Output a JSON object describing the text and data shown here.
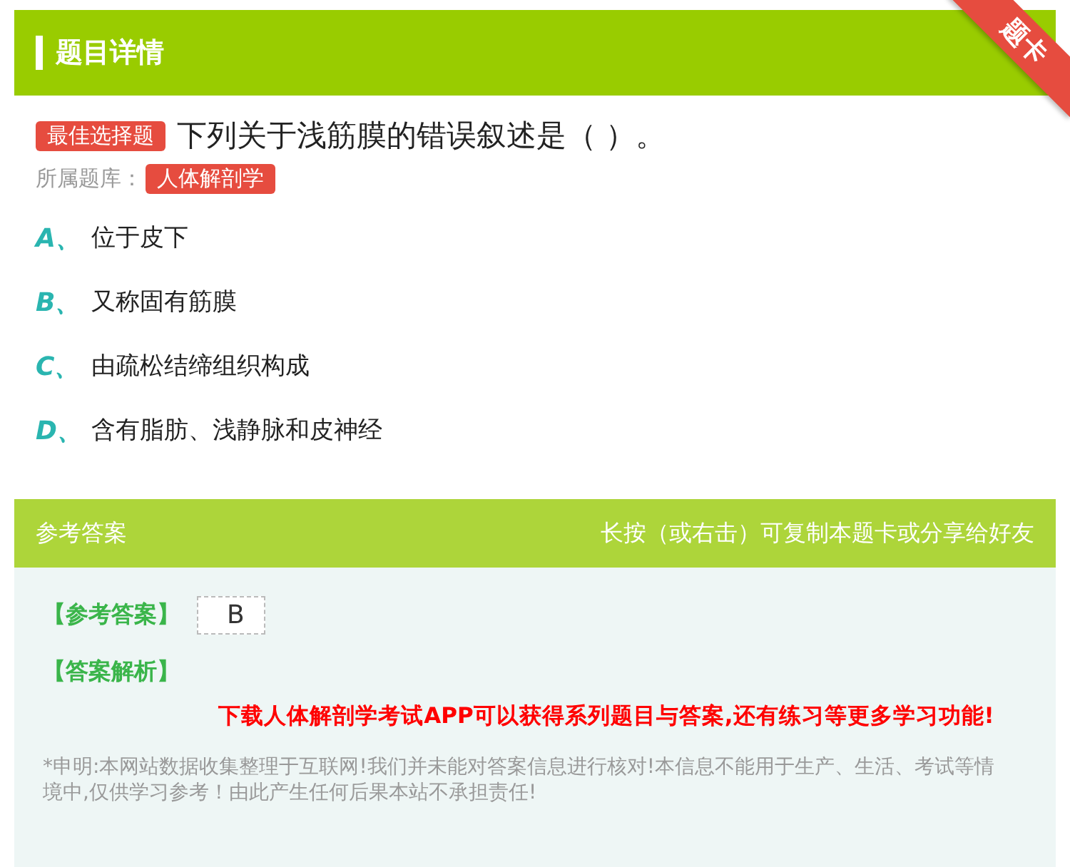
{
  "header": {
    "title": "题目详情",
    "ribbon": "题卡"
  },
  "question": {
    "type_badge": "最佳选择题",
    "text": "下列关于浅筋膜的错误叙述是（ ）。",
    "bank_label": "所属题库：",
    "bank": "人体解剖学"
  },
  "options": [
    {
      "letter": "A、",
      "text": "位于皮下"
    },
    {
      "letter": "B、",
      "text": "又称固有筋膜"
    },
    {
      "letter": "C、",
      "text": "由疏松结缔组织构成"
    },
    {
      "letter": "D、",
      "text": "含有脂肪、浅静脉和皮神经"
    }
  ],
  "answer": {
    "title": "参考答案",
    "hint": "长按（或右击）可复制本题卡或分享给好友",
    "answer_label": "【参考答案】",
    "answer_value": "B",
    "analysis_label": "【答案解析】",
    "promo": "下载人体解剖学考试APP可以获得系列题目与答案,还有练习等更多学习功能!",
    "disclaimer": "*申明:本网站数据收集整理于互联网!我们并未能对答案信息进行核对!本信息不能用于生产、生活、考试等情境中,仅供学习参考！由此产生任何后果本站不承担责任!"
  }
}
